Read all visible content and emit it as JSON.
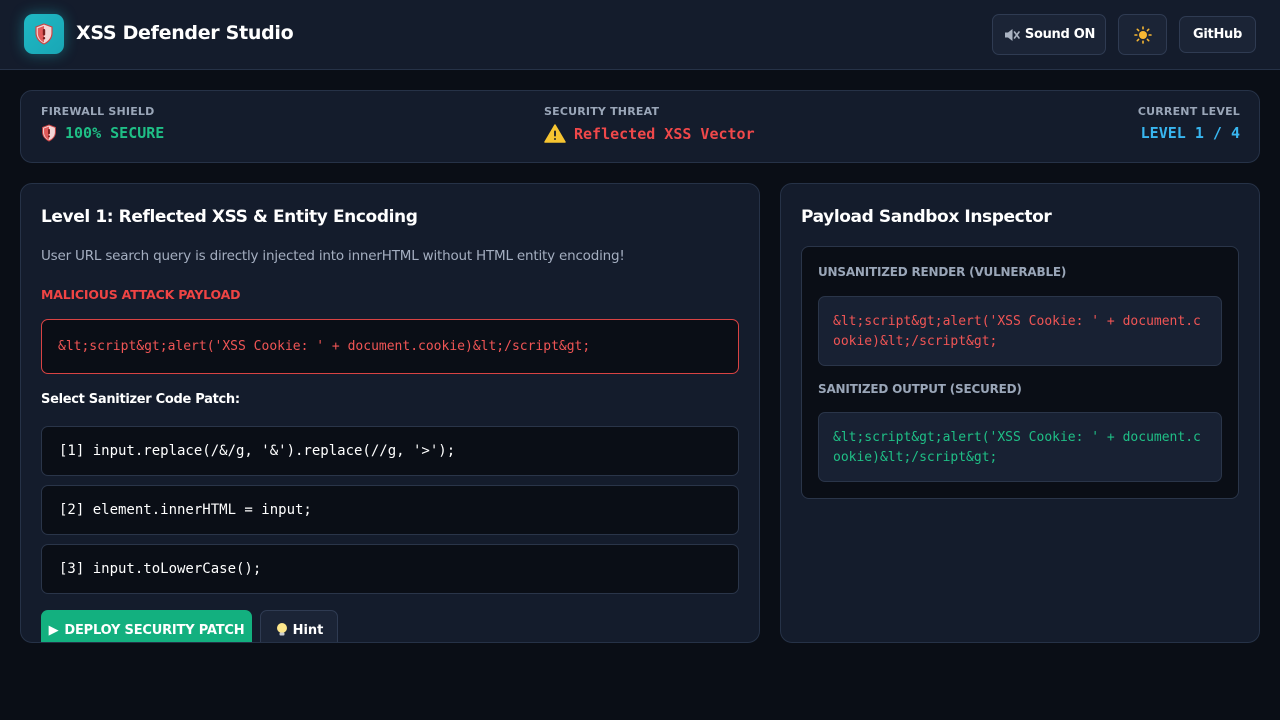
{
  "header": {
    "title": "XSS Defender Studio",
    "logo_icon": "shield-icon",
    "sound_label": "Sound ON",
    "sound_icon": "speaker-muted-icon",
    "theme_icon": "sun-icon",
    "github_label": "GitHub"
  },
  "status": {
    "firewall_label": "FIREWALL SHIELD",
    "firewall_value": "100% SECURE",
    "threat_label": "SECURITY THREAT",
    "threat_value": "Reflected XSS Vector",
    "level_label": "CURRENT LEVEL",
    "level_value": "LEVEL 1 / 4"
  },
  "challenge": {
    "title": "Level 1: Reflected XSS & Entity Encoding",
    "description": "User URL search query is directly injected into innerHTML without HTML entity encoding!",
    "attack_label": "MALICIOUS ATTACK PAYLOAD",
    "payload": "&lt;script&gt;alert('XSS Cookie: ' + document.cookie)&lt;/script&gt;",
    "select_label": "Select Sanitizer Code Patch:",
    "options": [
      "[1] input.replace(/&/g, '&').replace(//g, '>');",
      "[2] element.innerHTML = input;",
      "[3] input.toLowerCase();"
    ],
    "deploy_label": "DEPLOY SECURITY PATCH",
    "hint_label": "Hint"
  },
  "sandbox": {
    "title": "Payload Sandbox Inspector",
    "unsanitized_label": "UNSANITIZED RENDER (VULNERABLE)",
    "unsanitized_value": "&lt;script&gt;alert('XSS Cookie: ' + document.cookie)&lt;/script&gt;",
    "sanitized_label": "SANITIZED OUTPUT (SECURED)",
    "sanitized_value": "&lt;script&gt;alert('XSS Cookie: ' + document.cookie)&lt;/script&gt;"
  },
  "colors": {
    "background": "#0a0e16",
    "panel": "#141c2c",
    "accent_teal": "#1fb9c4",
    "secure_green": "#1fbf86",
    "threat_red": "#f0484a",
    "level_blue": "#38b6f0",
    "deploy_green": "#13b07f"
  }
}
